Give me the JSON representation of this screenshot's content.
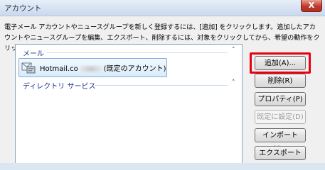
{
  "window": {
    "title": "アカウント",
    "close_glyph": "X"
  },
  "description": "電子メール アカウントやニュースグループを新しく登録するには、[追加] をクリックします。追加したアカウントやニュースグループを編集、エクスポート、削除するには、対象をクリックしてから、希望の動作をクリックします。",
  "list": {
    "groups": [
      {
        "label": "メール",
        "toggle": "˄"
      },
      {
        "label": "ディレクトリ サービス",
        "toggle": "˄"
      }
    ],
    "account": {
      "name_prefix": "Hotmail.co",
      "name_suffix": "(既定のアカウント)",
      "icon": "mail-account-icon"
    }
  },
  "buttons": {
    "add": "追加(A)...",
    "remove": "削除(R)",
    "properties": "プロパティ(P)",
    "set_default": "既定に設定(D)",
    "import": "インポート(I)...",
    "export": "エクスポート(E)..."
  },
  "colors": {
    "highlight": "#e60012",
    "group_text": "#1e3287"
  }
}
